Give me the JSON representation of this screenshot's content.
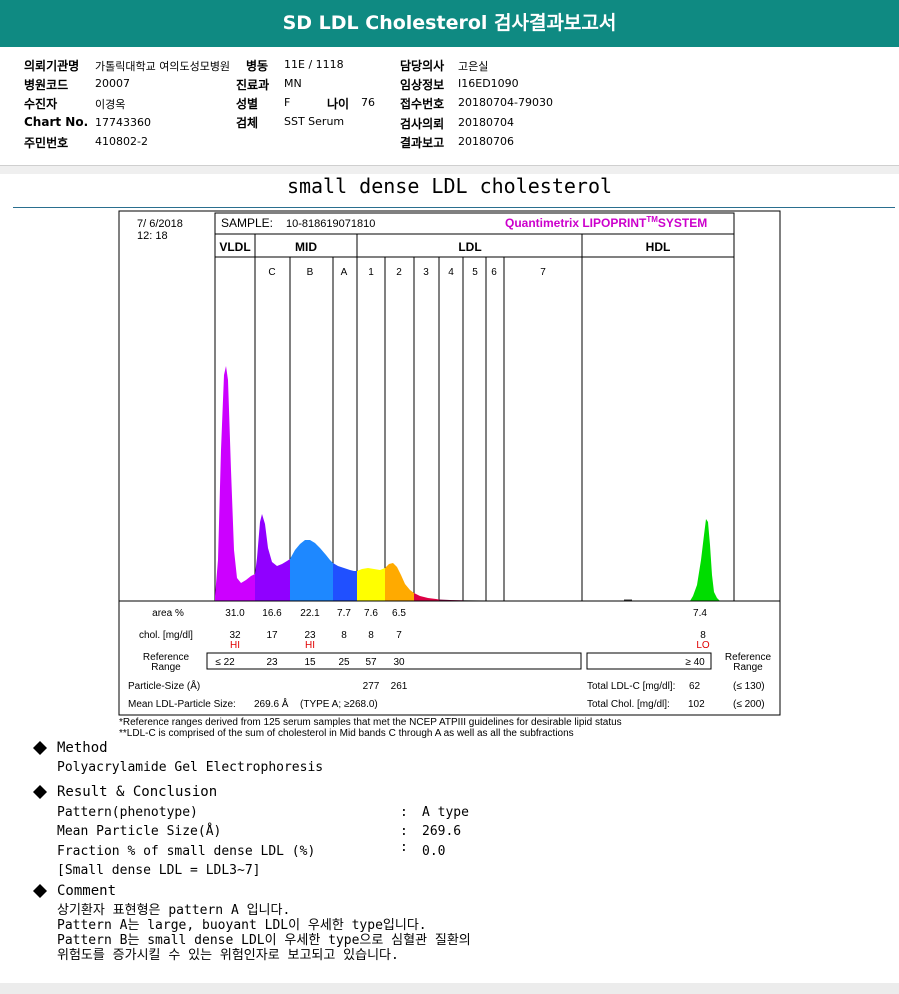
{
  "report": {
    "title": "SD LDL Cholesterol 검사결과보고서"
  },
  "patient": {
    "inst_label": "의뢰기관명",
    "inst_value": "가톨릭대학교 여의도성모병원",
    "ward_label": "병동",
    "ward_value": "11E / 1118",
    "doctor_label": "담당의사",
    "doctor_value": "고은실",
    "code_label": "병원코드",
    "code_value": "20007",
    "dept_label": "진료과",
    "dept_value": "MN",
    "clinical_label": "임상정보",
    "clinical_value": "I16ED1090",
    "name_label": "수진자",
    "name_value": "이경옥",
    "sex_label": "성별",
    "sex_value": "F",
    "age_label": "나이",
    "age_value": "76",
    "receipt_label": "접수번호",
    "receipt_value": "20180704-79030",
    "chart_label": "Chart No.",
    "chart_value": "17743360",
    "specimen_label": "검체",
    "specimen_value": "SST Serum",
    "request_label": "검사의뢰",
    "request_value": "20180704",
    "ssn_label": "주민번호",
    "ssn_value": "410802-2",
    "result_label": "결과보고",
    "result_value": "20180706"
  },
  "section_title": "small dense LDL cholesterol",
  "chart_data": {
    "type": "area",
    "title": "Quantimetrix LIPOPRINT",
    "title_sup": "TM",
    "title_suffix": "SYSTEM",
    "date": "7/ 6/2018",
    "time": "12: 18",
    "sample_label": "SAMPLE:",
    "sample_id": "10-818619071810",
    "band_groups": [
      "VLDL",
      "MID",
      "LDL",
      "HDL"
    ],
    "bands": [
      "C",
      "B",
      "A",
      "1",
      "2",
      "3",
      "4",
      "5",
      "6",
      "7"
    ],
    "peaks": [
      {
        "band": "VLDL",
        "rel_height": 0.85,
        "color": "#cc00ff"
      },
      {
        "band": "C",
        "rel_height": 0.29,
        "color": "#9000ff"
      },
      {
        "band": "B",
        "rel_height": 0.2,
        "color": "#1e88ff"
      },
      {
        "band": "A",
        "rel_height": 0.1,
        "color": "#2050ff"
      },
      {
        "band": "1",
        "rel_height": 0.09,
        "color": "#ffff00"
      },
      {
        "band": "2",
        "rel_height": 0.12,
        "color": "#ffaa00"
      },
      {
        "band": "3",
        "rel_height": 0.01,
        "color": "#dd0044"
      },
      {
        "band": "HDL",
        "rel_height": 0.27,
        "color": "#00dd00"
      }
    ],
    "rows": {
      "area_label": "area %",
      "area": [
        "31.0",
        "16.6",
        "22.1",
        "7.7",
        "7.6",
        "6.5"
      ],
      "area_hdl": "7.4",
      "chol_label": "chol. [mg/dl]",
      "chol": [
        "32",
        "17",
        "23",
        "8",
        "8",
        "7"
      ],
      "chol_flags": [
        "HI",
        "",
        "HI",
        "",
        "",
        ""
      ],
      "chol_hdl": "8",
      "chol_hdl_flag": "LO",
      "ref_label_1": "Reference",
      "ref_label_2": "Range",
      "ref": [
        "≤ 22",
        "23",
        "15",
        "25",
        "57",
        "30"
      ],
      "ref_hdl": "≥ 40",
      "ref_right_1": "Reference",
      "ref_right_2": "Range",
      "particle_label": "Particle-Size (Å)",
      "particle_1": "277",
      "particle_2": "261",
      "mean_label": "Mean LDL-Particle Size:",
      "mean_value": "269.6 Å",
      "mean_type": "(TYPE A; ≥268.0)",
      "total_ldl_label": "Total LDL-C [mg/dl]:",
      "total_ldl_value": "62",
      "total_ldl_ref": "(≤ 130)",
      "total_chol_label": "Total Chol. [mg/dl]:",
      "total_chol_value": "102",
      "total_chol_ref": "(≤ 200)"
    },
    "footnote_1": "*Reference ranges derived from 125 serum samples that met the NCEP ATPIII guidelines for desirable lipid status",
    "footnote_2": "**LDL-C is comprised of the sum of cholesterol in Mid bands C through A as well as all the subfractions"
  },
  "method": {
    "title": "Method",
    "text": "Polyacrylamide Gel Electrophoresis"
  },
  "result": {
    "title": "Result & Conclusion",
    "pattern_label": "Pattern(phenotype)",
    "pattern_value": "A type",
    "mps_label": "Mean Particle Size(Å)",
    "mps_value": "269.6",
    "fraction_label": "Fraction % of small dense LDL (%)",
    "fraction_value": "0.0",
    "note": "[Small dense LDL = LDL3~7]",
    "colon": ":"
  },
  "comment": {
    "title": "Comment",
    "lines": [
      "상기환자 표현형은 pattern A 입니다.",
      "Pattern A는 large, buoyant LDL이 우세한 type입니다.",
      "Pattern B는 small dense LDL이 우세한 type으로 심혈관 질환의",
      "위험도를 증가시킬 수 있는 위험인자로 보고되고 있습니다."
    ]
  },
  "icons": {
    "bullet": "diamond-bullet-icon"
  },
  "colors": {
    "header": "#0f8a82",
    "title_magenta": "#cc00cc",
    "flag": "#e00000"
  }
}
